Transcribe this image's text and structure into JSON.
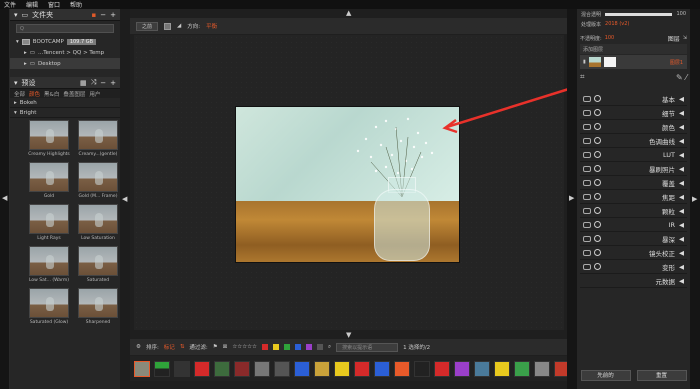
{
  "menu": {
    "items": [
      "文件",
      "编辑",
      "窗口",
      "帮助"
    ]
  },
  "folders_panel": {
    "title": "文件夹",
    "search_placeholder": "Q",
    "tree": [
      {
        "label": "BOOTCAMP",
        "size": "109.7 GB"
      },
      {
        "label": "...Tencent > QQ > Temp"
      },
      {
        "label": "Desktop"
      }
    ]
  },
  "presets_panel": {
    "title": "预设",
    "tabs": [
      "全部",
      "颜色",
      "黑&白",
      "叠盖图层",
      "用户"
    ],
    "sections": [
      "Bokeh",
      "Bright"
    ],
    "items": [
      {
        "label": "Creamy Highlights"
      },
      {
        "label": "Creamy...(gentle)"
      },
      {
        "label": "Gold"
      },
      {
        "label": "Gold (M... Frame)"
      },
      {
        "label": "Light Rays"
      },
      {
        "label": "Low Saturation"
      },
      {
        "label": "Low Sat... (Warm)"
      },
      {
        "label": "Saturated"
      },
      {
        "label": "Saturated (Glow)"
      },
      {
        "label": "Sharpened"
      }
    ]
  },
  "toolbar": {
    "view_button": "之前",
    "direction_label": "方向:",
    "direction_value": "平衡"
  },
  "bottom_bar": {
    "sort_label": "排序:",
    "sort_value": "标记",
    "filter_label": "通过滤:",
    "search_placeholder": "搜索以提示语",
    "selection": "1 选择的/2",
    "stars": "☆☆☆☆☆",
    "color_chips": [
      "#d42a2a",
      "#e8c91e",
      "#2fa33a",
      "#2b5fd6",
      "#9a3fc9",
      "#555555"
    ]
  },
  "right_panel": {
    "opacity_label": "混合透明",
    "opacity_value": "100",
    "version_label": "处理版本",
    "version_value": "2018 (v2)",
    "layer_opacity_label": "不透明度:",
    "layer_opacity_value": "100",
    "layers_tab": "图层",
    "layer_name": "图层1",
    "adjust_label": "添加图层",
    "adjustments": [
      "基本",
      "细节",
      "颜色",
      "色调曲线",
      "LUT",
      "暴刷照片",
      "覆盖",
      "焦距",
      "颗粒",
      "IR",
      "暴深",
      "镜头校正",
      "变形",
      "元数据"
    ],
    "buttons": {
      "previous": "先前的",
      "reset": "重置"
    }
  }
}
